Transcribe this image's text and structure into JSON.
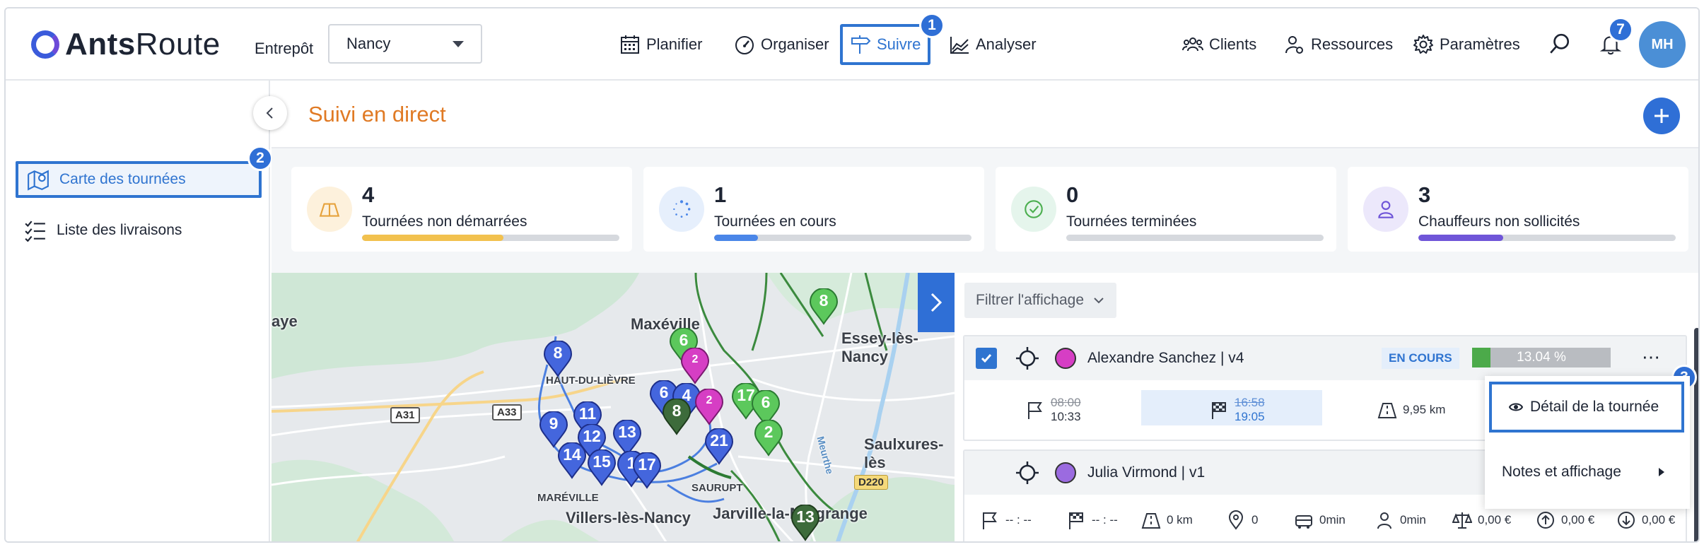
{
  "brand": {
    "bold": "Ants",
    "light": "Route"
  },
  "warehouse": {
    "label": "Entrepôt",
    "value": "Nancy"
  },
  "nav": {
    "planifier": "Planifier",
    "organiser": "Organiser",
    "suivre": "Suivre",
    "analyser": "Analyser",
    "clients": "Clients",
    "ressources": "Ressources",
    "parametres": "Paramètres"
  },
  "notifications_count": "7",
  "avatar_initials": "MH",
  "step_badges": {
    "one": "1",
    "two": "2",
    "three": "3"
  },
  "sidebar": {
    "items": [
      {
        "label": "Carte des tournées"
      },
      {
        "label": "Liste des livraisons"
      }
    ]
  },
  "page": {
    "title": "Suivi en direct"
  },
  "stats": [
    {
      "count": "4",
      "label": "Tournées non démarrées",
      "progress": 0.55,
      "color": "#f2c14e",
      "icon_bg": "#fdf1dc",
      "icon": "map-icon"
    },
    {
      "count": "1",
      "label": "Tournées en cours",
      "progress": 0.17,
      "color": "#4a86e8",
      "icon_bg": "#e6effc",
      "icon": "loading-icon"
    },
    {
      "count": "0",
      "label": "Tournées terminées",
      "progress": 0,
      "color": "#4caf50",
      "icon_bg": "#e5f5ec",
      "icon": "check-icon"
    },
    {
      "count": "3",
      "label": "Chauffeurs non sollicités",
      "progress": 0.33,
      "color": "#6f55d8",
      "icon_bg": "#ece8fb",
      "icon": "user-icon"
    }
  ],
  "map": {
    "labels": {
      "haye": "aye",
      "maxeville": "Maxéville",
      "essey": "Essey-lès-Nancy",
      "haut_du_lievre": "HAUT-DU-LIÈVRE",
      "saulxures": "Saulxures-lès",
      "saurupt": "SAURUPT",
      "mareville": "MARÉVILLE",
      "villers": "Villers-lès-Nancy",
      "jarville": "Jarville-la-Malgrange",
      "meurthe": "Meurthe"
    },
    "roads": {
      "a31": "A31",
      "a33": "A33",
      "d220": "D220"
    },
    "pins": {
      "p8a": "8",
      "p8b": "8",
      "p9": "9",
      "p11": "11",
      "p12": "12",
      "p13": "13",
      "p14": "14",
      "p15": "15",
      "p17a": "17",
      "p1": "1",
      "p6a": "6",
      "p6b": "6",
      "p4": "4",
      "p2a": "2",
      "p2b": "2",
      "p21": "21",
      "p17b": "17",
      "p6c": "6",
      "p2c": "2",
      "p13b": "13"
    }
  },
  "panel": {
    "filter_label": "Filtrer l'affichage",
    "routes": [
      {
        "name": "Alexandre Sanchez | v4",
        "color": "#d63ec4",
        "status": "EN COURS",
        "progress_label": "13.04 %",
        "progress": 0.1304,
        "start_planned": "08:00",
        "start_actual": "10:33",
        "end_planned": "16:58",
        "end_actual": "19:05",
        "distance": "9,95 km"
      },
      {
        "name": "Julia Virmond | v1",
        "color": "#9b6be0",
        "start": "-- : --",
        "end": "-- : --",
        "distance": "0 km",
        "stops": "0",
        "drive_time": "0min",
        "work_time": "0min",
        "cost_a": "0,00 €",
        "cost_b": "0,00 €",
        "cost_c": "0,00 €"
      }
    ]
  },
  "context_menu": {
    "detail": "Détail de la tournée",
    "notes": "Notes et affichage"
  }
}
